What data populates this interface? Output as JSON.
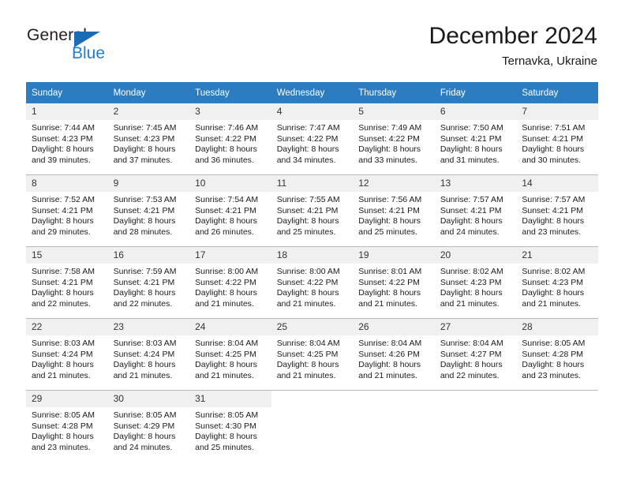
{
  "logo": {
    "word_one": "General",
    "word_two": "Blue",
    "triangle_color": "#1c6cb5",
    "blue_text_color": "#1c7fd4"
  },
  "header": {
    "month_title": "December 2024",
    "location": "Ternavka, Ukraine"
  },
  "calendar": {
    "accent_color": "#2b7cc0",
    "daynum_band_color": "#f0f0f0",
    "weekday_headers": [
      "Sunday",
      "Monday",
      "Tuesday",
      "Wednesday",
      "Thursday",
      "Friday",
      "Saturday"
    ],
    "weeks": [
      [
        {
          "day": "1",
          "sunrise": "Sunrise: 7:44 AM",
          "sunset": "Sunset: 4:23 PM",
          "daylight_line1": "Daylight: 8 hours",
          "daylight_line2": "and 39 minutes."
        },
        {
          "day": "2",
          "sunrise": "Sunrise: 7:45 AM",
          "sunset": "Sunset: 4:23 PM",
          "daylight_line1": "Daylight: 8 hours",
          "daylight_line2": "and 37 minutes."
        },
        {
          "day": "3",
          "sunrise": "Sunrise: 7:46 AM",
          "sunset": "Sunset: 4:22 PM",
          "daylight_line1": "Daylight: 8 hours",
          "daylight_line2": "and 36 minutes."
        },
        {
          "day": "4",
          "sunrise": "Sunrise: 7:47 AM",
          "sunset": "Sunset: 4:22 PM",
          "daylight_line1": "Daylight: 8 hours",
          "daylight_line2": "and 34 minutes."
        },
        {
          "day": "5",
          "sunrise": "Sunrise: 7:49 AM",
          "sunset": "Sunset: 4:22 PM",
          "daylight_line1": "Daylight: 8 hours",
          "daylight_line2": "and 33 minutes."
        },
        {
          "day": "6",
          "sunrise": "Sunrise: 7:50 AM",
          "sunset": "Sunset: 4:21 PM",
          "daylight_line1": "Daylight: 8 hours",
          "daylight_line2": "and 31 minutes."
        },
        {
          "day": "7",
          "sunrise": "Sunrise: 7:51 AM",
          "sunset": "Sunset: 4:21 PM",
          "daylight_line1": "Daylight: 8 hours",
          "daylight_line2": "and 30 minutes."
        }
      ],
      [
        {
          "day": "8",
          "sunrise": "Sunrise: 7:52 AM",
          "sunset": "Sunset: 4:21 PM",
          "daylight_line1": "Daylight: 8 hours",
          "daylight_line2": "and 29 minutes."
        },
        {
          "day": "9",
          "sunrise": "Sunrise: 7:53 AM",
          "sunset": "Sunset: 4:21 PM",
          "daylight_line1": "Daylight: 8 hours",
          "daylight_line2": "and 28 minutes."
        },
        {
          "day": "10",
          "sunrise": "Sunrise: 7:54 AM",
          "sunset": "Sunset: 4:21 PM",
          "daylight_line1": "Daylight: 8 hours",
          "daylight_line2": "and 26 minutes."
        },
        {
          "day": "11",
          "sunrise": "Sunrise: 7:55 AM",
          "sunset": "Sunset: 4:21 PM",
          "daylight_line1": "Daylight: 8 hours",
          "daylight_line2": "and 25 minutes."
        },
        {
          "day": "12",
          "sunrise": "Sunrise: 7:56 AM",
          "sunset": "Sunset: 4:21 PM",
          "daylight_line1": "Daylight: 8 hours",
          "daylight_line2": "and 25 minutes."
        },
        {
          "day": "13",
          "sunrise": "Sunrise: 7:57 AM",
          "sunset": "Sunset: 4:21 PM",
          "daylight_line1": "Daylight: 8 hours",
          "daylight_line2": "and 24 minutes."
        },
        {
          "day": "14",
          "sunrise": "Sunrise: 7:57 AM",
          "sunset": "Sunset: 4:21 PM",
          "daylight_line1": "Daylight: 8 hours",
          "daylight_line2": "and 23 minutes."
        }
      ],
      [
        {
          "day": "15",
          "sunrise": "Sunrise: 7:58 AM",
          "sunset": "Sunset: 4:21 PM",
          "daylight_line1": "Daylight: 8 hours",
          "daylight_line2": "and 22 minutes."
        },
        {
          "day": "16",
          "sunrise": "Sunrise: 7:59 AM",
          "sunset": "Sunset: 4:21 PM",
          "daylight_line1": "Daylight: 8 hours",
          "daylight_line2": "and 22 minutes."
        },
        {
          "day": "17",
          "sunrise": "Sunrise: 8:00 AM",
          "sunset": "Sunset: 4:22 PM",
          "daylight_line1": "Daylight: 8 hours",
          "daylight_line2": "and 21 minutes."
        },
        {
          "day": "18",
          "sunrise": "Sunrise: 8:00 AM",
          "sunset": "Sunset: 4:22 PM",
          "daylight_line1": "Daylight: 8 hours",
          "daylight_line2": "and 21 minutes."
        },
        {
          "day": "19",
          "sunrise": "Sunrise: 8:01 AM",
          "sunset": "Sunset: 4:22 PM",
          "daylight_line1": "Daylight: 8 hours",
          "daylight_line2": "and 21 minutes."
        },
        {
          "day": "20",
          "sunrise": "Sunrise: 8:02 AM",
          "sunset": "Sunset: 4:23 PM",
          "daylight_line1": "Daylight: 8 hours",
          "daylight_line2": "and 21 minutes."
        },
        {
          "day": "21",
          "sunrise": "Sunrise: 8:02 AM",
          "sunset": "Sunset: 4:23 PM",
          "daylight_line1": "Daylight: 8 hours",
          "daylight_line2": "and 21 minutes."
        }
      ],
      [
        {
          "day": "22",
          "sunrise": "Sunrise: 8:03 AM",
          "sunset": "Sunset: 4:24 PM",
          "daylight_line1": "Daylight: 8 hours",
          "daylight_line2": "and 21 minutes."
        },
        {
          "day": "23",
          "sunrise": "Sunrise: 8:03 AM",
          "sunset": "Sunset: 4:24 PM",
          "daylight_line1": "Daylight: 8 hours",
          "daylight_line2": "and 21 minutes."
        },
        {
          "day": "24",
          "sunrise": "Sunrise: 8:04 AM",
          "sunset": "Sunset: 4:25 PM",
          "daylight_line1": "Daylight: 8 hours",
          "daylight_line2": "and 21 minutes."
        },
        {
          "day": "25",
          "sunrise": "Sunrise: 8:04 AM",
          "sunset": "Sunset: 4:25 PM",
          "daylight_line1": "Daylight: 8 hours",
          "daylight_line2": "and 21 minutes."
        },
        {
          "day": "26",
          "sunrise": "Sunrise: 8:04 AM",
          "sunset": "Sunset: 4:26 PM",
          "daylight_line1": "Daylight: 8 hours",
          "daylight_line2": "and 21 minutes."
        },
        {
          "day": "27",
          "sunrise": "Sunrise: 8:04 AM",
          "sunset": "Sunset: 4:27 PM",
          "daylight_line1": "Daylight: 8 hours",
          "daylight_line2": "and 22 minutes."
        },
        {
          "day": "28",
          "sunrise": "Sunrise: 8:05 AM",
          "sunset": "Sunset: 4:28 PM",
          "daylight_line1": "Daylight: 8 hours",
          "daylight_line2": "and 23 minutes."
        }
      ],
      [
        {
          "day": "29",
          "sunrise": "Sunrise: 8:05 AM",
          "sunset": "Sunset: 4:28 PM",
          "daylight_line1": "Daylight: 8 hours",
          "daylight_line2": "and 23 minutes."
        },
        {
          "day": "30",
          "sunrise": "Sunrise: 8:05 AM",
          "sunset": "Sunset: 4:29 PM",
          "daylight_line1": "Daylight: 8 hours",
          "daylight_line2": "and 24 minutes."
        },
        {
          "day": "31",
          "sunrise": "Sunrise: 8:05 AM",
          "sunset": "Sunset: 4:30 PM",
          "daylight_line1": "Daylight: 8 hours",
          "daylight_line2": "and 25 minutes."
        },
        {
          "day": "",
          "sunrise": "",
          "sunset": "",
          "daylight_line1": "",
          "daylight_line2": ""
        },
        {
          "day": "",
          "sunrise": "",
          "sunset": "",
          "daylight_line1": "",
          "daylight_line2": ""
        },
        {
          "day": "",
          "sunrise": "",
          "sunset": "",
          "daylight_line1": "",
          "daylight_line2": ""
        },
        {
          "day": "",
          "sunrise": "",
          "sunset": "",
          "daylight_line1": "",
          "daylight_line2": ""
        }
      ]
    ]
  }
}
